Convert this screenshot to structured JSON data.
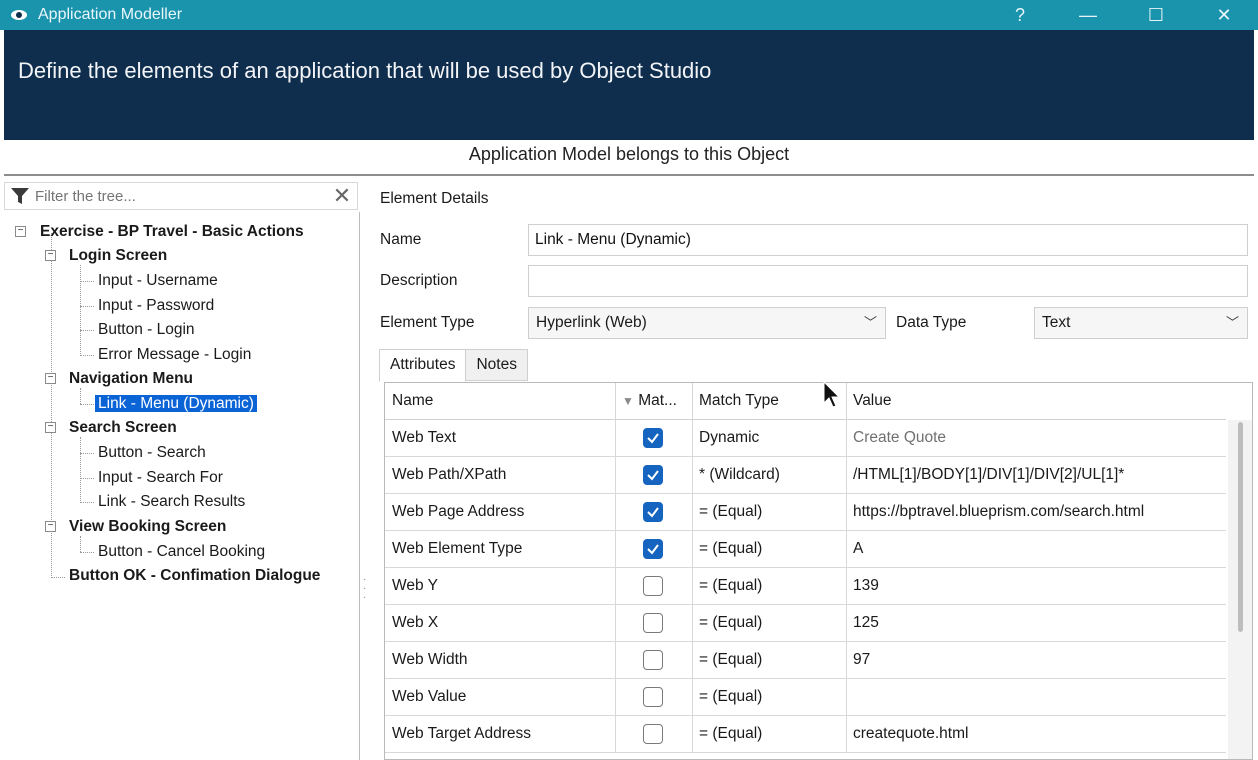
{
  "window": {
    "title": "Application Modeller",
    "help_label": "?",
    "minimize_label": "—",
    "maximize_label": "☐",
    "close_label": "✕"
  },
  "banner": {
    "text": "Define the elements of an application that will be used by Object Studio"
  },
  "object_label": "Application Model belongs to this Object",
  "tree": {
    "filter_placeholder": "Filter the tree...",
    "root": "Exercise - BP Travel - Basic Actions",
    "groups": [
      {
        "label": "Login Screen",
        "children": [
          "Input - Username",
          "Input - Password",
          "Button - Login",
          "Error Message - Login"
        ]
      },
      {
        "label": "Navigation Menu",
        "children": [
          "Link - Menu (Dynamic)"
        ]
      },
      {
        "label": "Search Screen",
        "children": [
          "Button - Search",
          "Input - Search For",
          "Link - Search Results"
        ]
      },
      {
        "label": "View Booking Screen",
        "children": [
          "Button - Cancel Booking"
        ]
      }
    ],
    "loose_item": "Button OK - Confimation Dialogue",
    "selected": "Link - Menu (Dynamic)"
  },
  "details": {
    "title": "Element Details",
    "name_label": "Name",
    "name_value": "Link - Menu (Dynamic)",
    "description_label": "Description",
    "description_value": "",
    "element_type_label": "Element Type",
    "element_type_value": "Hyperlink (Web)",
    "data_type_label": "Data Type",
    "data_type_value": "Text"
  },
  "tabs": [
    {
      "label": "Attributes",
      "active": true
    },
    {
      "label": "Notes",
      "active": false
    }
  ],
  "grid": {
    "columns": [
      "Name",
      "Mat...",
      "Match Type",
      "Value"
    ],
    "rows": [
      {
        "name": "Web Text",
        "match": true,
        "match_type": "Dynamic",
        "value": "Create Quote",
        "value_dim": true
      },
      {
        "name": "Web Path/XPath",
        "match": true,
        "match_type": "*  (Wildcard)",
        "value": "/HTML[1]/BODY[1]/DIV[1]/DIV[2]/UL[1]*",
        "value_dim": false
      },
      {
        "name": "Web Page Address",
        "match": true,
        "match_type": "=  (Equal)",
        "value": "https://bptravel.blueprism.com/search.html",
        "value_dim": false
      },
      {
        "name": "Web Element Type",
        "match": true,
        "match_type": "=  (Equal)",
        "value": "A",
        "value_dim": false
      },
      {
        "name": "Web Y",
        "match": false,
        "match_type": "=  (Equal)",
        "value": "139",
        "value_dim": false
      },
      {
        "name": "Web X",
        "match": false,
        "match_type": "=  (Equal)",
        "value": "125",
        "value_dim": false
      },
      {
        "name": "Web Width",
        "match": false,
        "match_type": "=  (Equal)",
        "value": "97",
        "value_dim": false
      },
      {
        "name": "Web Value",
        "match": false,
        "match_type": "=  (Equal)",
        "value": "",
        "value_dim": false
      },
      {
        "name": "Web Target Address",
        "match": false,
        "match_type": "=  (Equal)",
        "value": "createquote.html",
        "value_dim": false
      }
    ]
  },
  "colors": {
    "titlebar": "#1a93ad",
    "banner": "#0f2e4d",
    "selection": "#0a64d6",
    "checkbox_on": "#1565c0"
  }
}
